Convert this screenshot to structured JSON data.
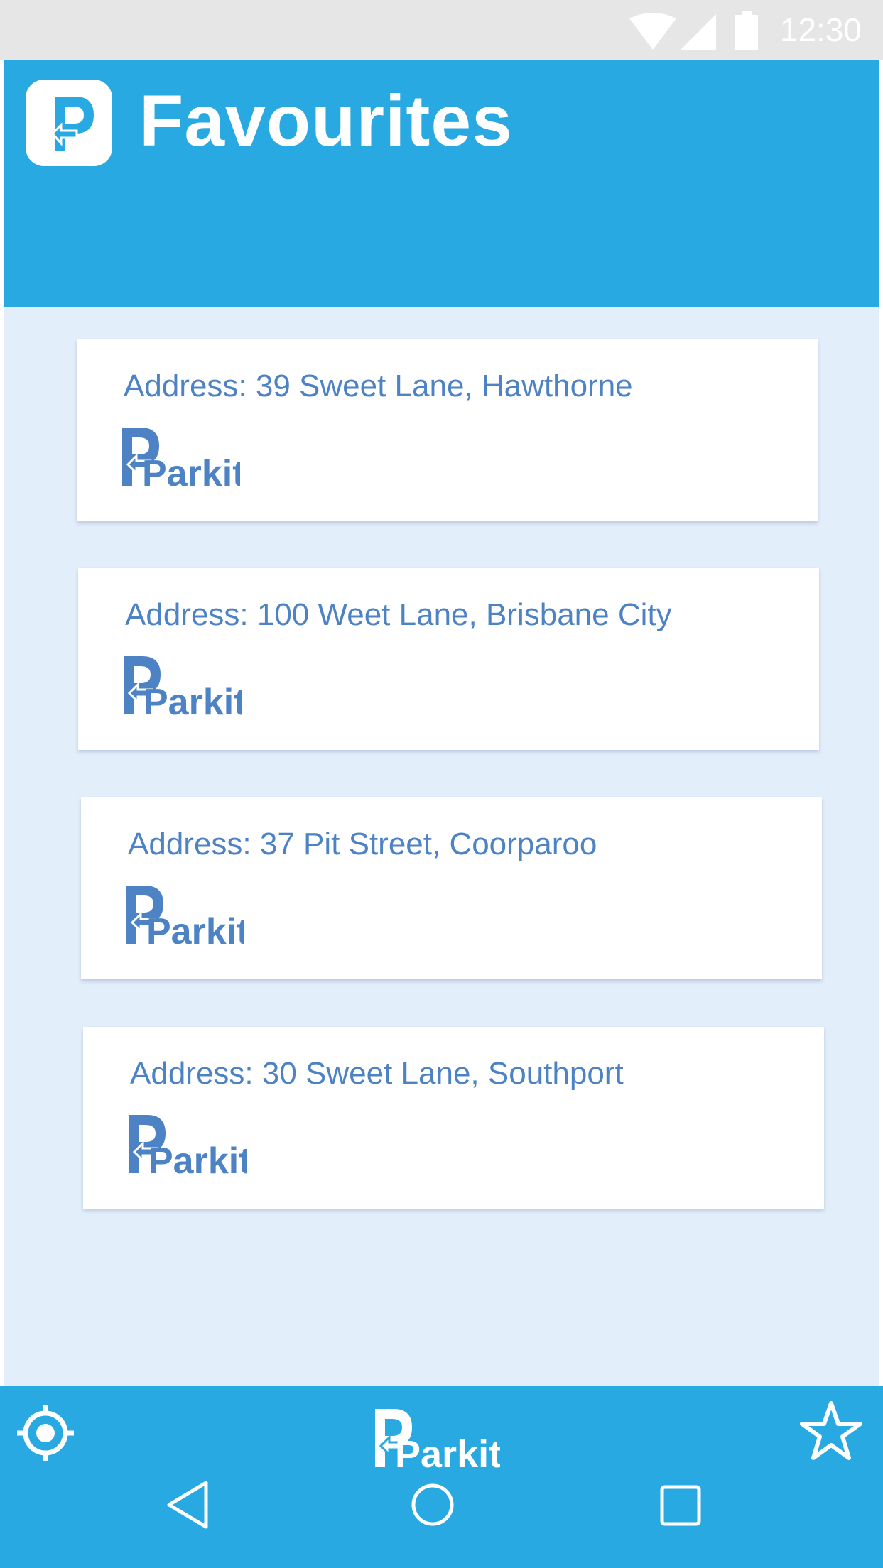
{
  "status_bar": {
    "time": "12:30",
    "icons": [
      "wifi-icon",
      "cellular-signal-icon",
      "battery-icon"
    ]
  },
  "header": {
    "logo_icon": "parkit-p-logo-icon",
    "title": "Favourites"
  },
  "favourites": [
    {
      "address": "Address: 39 Sweet Lane, Hawthorne",
      "brand": "Parkit."
    },
    {
      "address": "Address: 100 Weet Lane, Brisbane City",
      "brand": "Parkit."
    },
    {
      "address": "Address: 37 Pit Street, Coorparoo",
      "brand": "Parkit."
    },
    {
      "address": "Address: 30 Sweet Lane, Southport",
      "brand": "Parkit."
    }
  ],
  "bottom_nav": {
    "left_icon": "locate-crosshair-icon",
    "center_logo": "Parkit.",
    "right_icon": "star-icon"
  },
  "system_nav": {
    "icons": [
      "back-triangle-icon",
      "home-circle-icon",
      "recents-square-icon"
    ]
  },
  "colors": {
    "primary": "#29a9e1",
    "background": "#e3eefb",
    "card_text": "#4d83c4",
    "status_bar": "#e6e6e6"
  }
}
